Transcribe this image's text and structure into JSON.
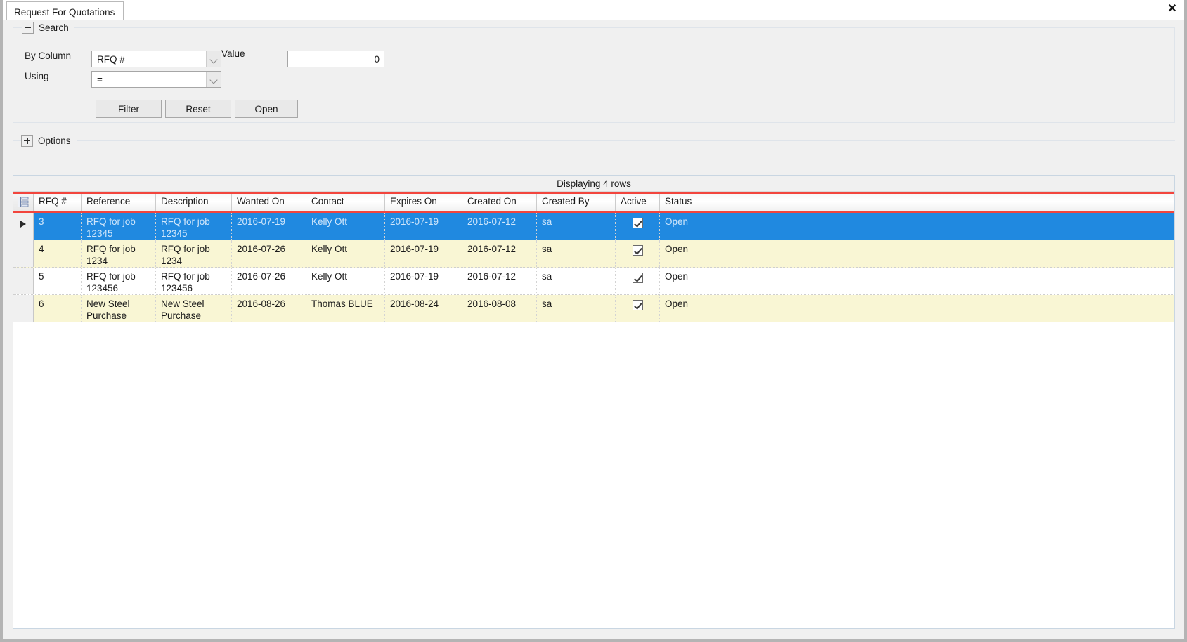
{
  "window": {
    "close_label": "✕"
  },
  "tab": {
    "label": "Request For Quotations"
  },
  "search_group": {
    "title": "Search",
    "expander": "minus",
    "by_column_label": "By Column",
    "by_column_value": "RFQ #",
    "using_label": "Using",
    "using_value": "=",
    "value_label": "Value",
    "value_input": "0",
    "value_placeholder": "",
    "buttons": {
      "filter": "Filter",
      "reset": "Reset",
      "open": "Open"
    }
  },
  "options_group": {
    "title": "Options",
    "expander": "plus"
  },
  "grid": {
    "status_text": "Displaying 4 rows",
    "sort_indicator": "/",
    "corner_icon": "column-chooser-icon",
    "columns": [
      "RFQ #",
      "Reference",
      "Description",
      "Wanted On",
      "Contact",
      "Expires On",
      "Created On",
      "Created By",
      "Active",
      "Status"
    ],
    "rows": [
      {
        "rfq": "3",
        "reference": "RFQ for job 12345",
        "description": "RFQ for job 12345",
        "wanted_on": "2016-07-19",
        "contact": "Kelly Ott",
        "expires_on": "2016-07-19",
        "created_on": "2016-07-12",
        "created_by": "sa",
        "active": true,
        "status": "Open",
        "style": "selected"
      },
      {
        "rfq": "4",
        "reference": "RFQ for job 1234",
        "description": "RFQ for job 1234",
        "wanted_on": "2016-07-26",
        "contact": "Kelly Ott",
        "expires_on": "2016-07-19",
        "created_on": "2016-07-12",
        "created_by": "sa",
        "active": true,
        "status": "Open",
        "style": "alt"
      },
      {
        "rfq": "5",
        "reference": "RFQ for job 123456",
        "description": "RFQ for job 123456",
        "wanted_on": "2016-07-26",
        "contact": "Kelly Ott",
        "expires_on": "2016-07-19",
        "created_on": "2016-07-12",
        "created_by": "sa",
        "active": true,
        "status": "Open",
        "style": "plain"
      },
      {
        "rfq": "6",
        "reference": "New Steel Purchase",
        "description": "New Steel Purchase",
        "wanted_on": "2016-08-26",
        "contact": "Thomas BLUE",
        "expires_on": "2016-08-24",
        "created_on": "2016-08-08",
        "created_by": "sa",
        "active": true,
        "status": "Open",
        "style": "alt"
      }
    ]
  },
  "colors": {
    "selection_blue": "#2089e0",
    "alt_row_yellow": "#f9f6d4",
    "focus_red": "#f2453d",
    "window_chrome": "#f0f0f0"
  }
}
